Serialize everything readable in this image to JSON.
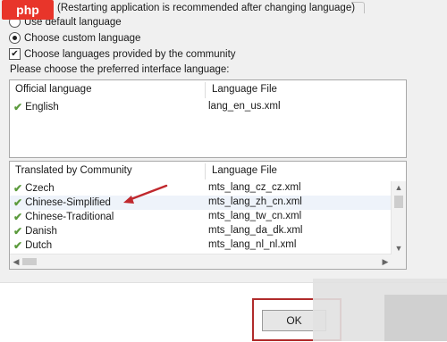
{
  "logo": {
    "text": "php"
  },
  "note": {
    "text": "(Restarting application is recommended after changing language)"
  },
  "options": {
    "default_language": "Use default language",
    "custom_language": "Choose custom language",
    "community_languages": "Choose languages provided by the community",
    "selected": "custom_language",
    "community_checked": true
  },
  "prompt": "Please choose the preferred interface language:",
  "official": {
    "header_name": "Official language",
    "header_file": "Language File",
    "rows": [
      {
        "name": "English",
        "file": "lang_en_us.xml"
      }
    ]
  },
  "community": {
    "header_name": "Translated by Community",
    "header_file": "Language File",
    "rows": [
      {
        "name": "Czech",
        "file": "mts_lang_cz_cz.xml"
      },
      {
        "name": "Chinese-Simplified",
        "file": "mts_lang_zh_cn.xml"
      },
      {
        "name": "Chinese-Traditional",
        "file": "mts_lang_tw_cn.xml"
      },
      {
        "name": "Danish",
        "file": "mts_lang_da_dk.xml"
      },
      {
        "name": "Dutch",
        "file": "mts_lang_nl_nl.xml"
      }
    ],
    "highlighted_row": 1
  },
  "buttons": {
    "ok": "OK"
  },
  "colors": {
    "annotation_red": "#c0282d",
    "check_green": "#5b9a3c"
  }
}
